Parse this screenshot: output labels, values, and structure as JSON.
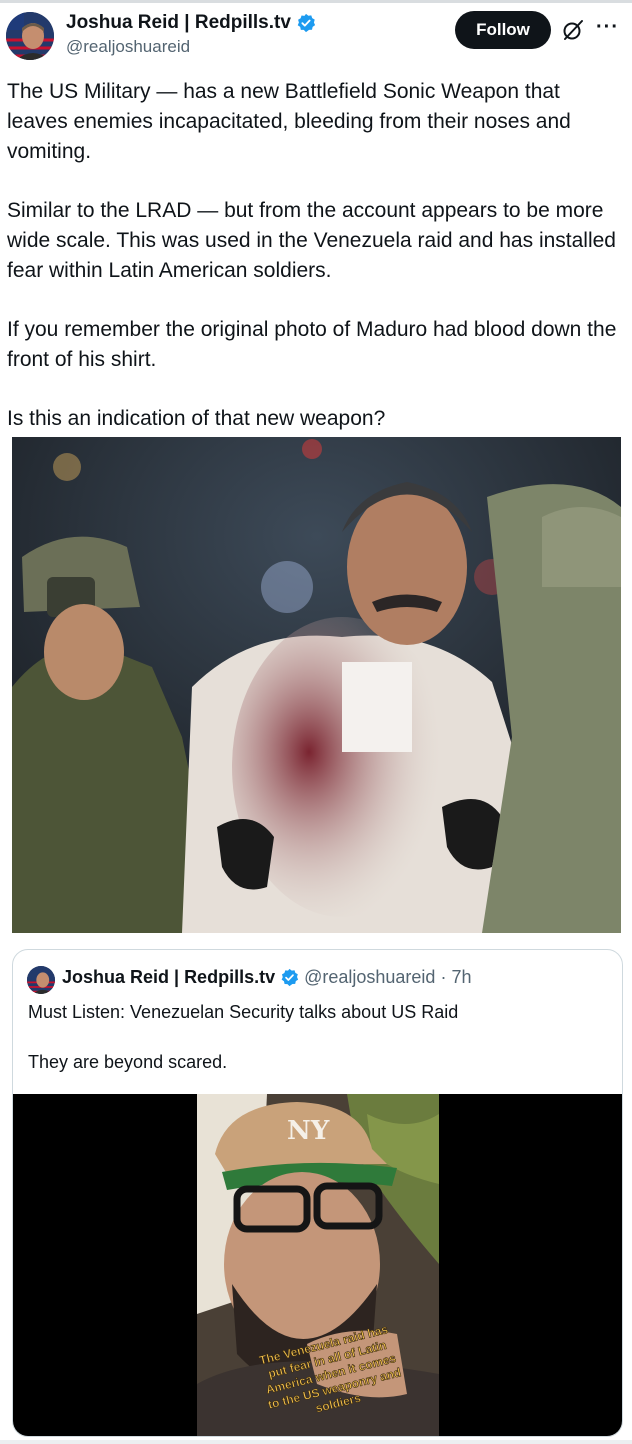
{
  "post": {
    "author_name": "Joshua Reid | Redpills.tv",
    "handle": "@realjoshuareid",
    "follow_label": "Follow",
    "more_label": "···",
    "paragraphs": [
      "The US Military — has a new Battlefield Sonic Weapon that leaves enemies incapacitated, bleeding from their noses and vomiting.",
      "Similar to the LRAD — but from the account appears to be more wide scale. This was used in the Venezuela raid and has installed fear within Latin American soldiers.",
      "If you remember the original photo of Maduro had blood down the front of his shirt.",
      "Is this an indication of that new weapon?"
    ]
  },
  "quote": {
    "author_name": "Joshua Reid | Redpills.tv",
    "handle": "@realjoshuareid",
    "separator": "·",
    "time": "7h",
    "paragraphs": [
      "Must Listen: Venezuelan Security talks about US Raid",
      "They are beyond scared."
    ],
    "video_caption_lines": [
      "The Venezuela raid has",
      "put fear in all of Latin",
      "America when it comes",
      "to the US weaponry and",
      "soldiers"
    ]
  },
  "colors": {
    "verified": "#1d9bf0",
    "text": "#0f1419",
    "secondary": "#536471",
    "caption": "#f2c14e"
  },
  "icons": [
    "verified-badge-icon",
    "grok-icon",
    "more-icon"
  ]
}
